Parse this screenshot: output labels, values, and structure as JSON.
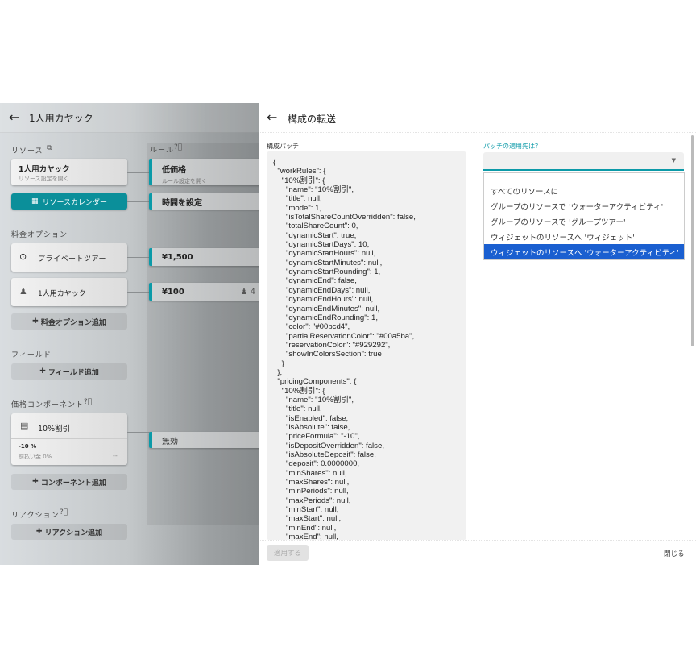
{
  "left": {
    "title": "1人用カヤック",
    "resources_label": "リソース",
    "rules_label": "ルール",
    "resource_card": {
      "title": "1人用カヤック",
      "subtitle": "リソース設定を開く"
    },
    "calendar_button": "リソースカレンダー",
    "rules": [
      {
        "title": "低価格",
        "subtitle": "ルール設定を開く"
      },
      {
        "title": "時間を設定"
      }
    ],
    "pricing_label": "料金オプション",
    "pricing_options": [
      {
        "name": "プライベートツアー",
        "price": "¥1,500"
      },
      {
        "name": "1人用カヤック",
        "price": "¥100",
        "count": "4"
      }
    ],
    "add_pricing": "料金オプション追加",
    "fields_label": "フィールド",
    "add_field": "フィールド追加",
    "components_label": "価格コンポーネント",
    "component": {
      "name": "10%割引",
      "value": "-10 %",
      "deposit": "前払い金 0%",
      "more": "--",
      "rule": "無効"
    },
    "add_component": "コンポーネント追加",
    "reactions_label": "リアクション",
    "add_reaction": "リアクション追加"
  },
  "dialog": {
    "title": "構成の転送",
    "patch_label": "構成パッチ",
    "target_label": "パッチの適用先は？",
    "select_value": "",
    "options": [
      "すべてのリソースに",
      "グループのリソースで 'ウォーターアクティビティ'",
      "グループのリソースで 'グループツアー'",
      "ウィジェットのリソースへ 'ウィジェット'",
      "ウィジェットのリソースへ 'ウォーターアクティビティ'"
    ],
    "selected_index": 4,
    "apply_button": "適用する",
    "close_button": "閉じる",
    "accent": "#0b9aa8",
    "highlight": "#1a5fd0",
    "code_lines": [
      "{",
      "  \"workRules\": {",
      "    \"10%割引\": {",
      "      \"name\": \"10%割引\",",
      "      \"title\": null,",
      "      \"mode\": 1,",
      "      \"isTotalShareCountOverridden\": false,",
      "      \"totalShareCount\": 0,",
      "      \"dynamicStart\": true,",
      "      \"dynamicStartDays\": 10,",
      "      \"dynamicStartHours\": null,",
      "      \"dynamicStartMinutes\": null,",
      "      \"dynamicStartRounding\": 1,",
      "      \"dynamicEnd\": false,",
      "      \"dynamicEndDays\": null,",
      "      \"dynamicEndHours\": null,",
      "      \"dynamicEndMinutes\": null,",
      "      \"dynamicEndRounding\": 1,",
      "      \"color\": \"#00bcd4\",",
      "      \"partialReservationColor\": \"#00a5ba\",",
      "      \"reservationColor\": \"#929292\",",
      "      \"showInColorsSection\": true",
      "    }",
      "  },",
      "  \"pricingComponents\": {",
      "    \"10%割引\": {",
      "      \"name\": \"10%割引\",",
      "      \"title\": null,",
      "      \"isEnabled\": false,",
      "      \"isAbsolute\": false,",
      "      \"priceFormula\": \"-10\",",
      "      \"isDepositOverridden\": false,",
      "      \"isAbsoluteDeposit\": false,",
      "      \"deposit\": 0.0000000,",
      "      \"minShares\": null,",
      "      \"maxShares\": null,",
      "      \"minPeriods\": null,",
      "      \"maxPeriods\": null,",
      "      \"minStart\": null,",
      "      \"maxStart\": null,",
      "      \"minEnd\": null,",
      "      \"maxEnd\": null,"
    ]
  }
}
